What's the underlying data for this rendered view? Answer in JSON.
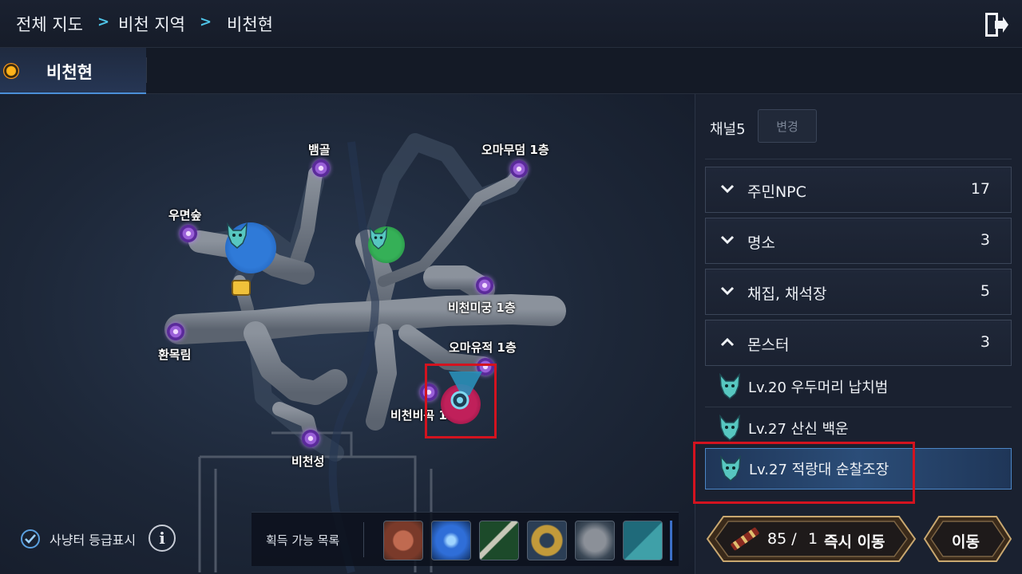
{
  "breadcrumb": {
    "items": [
      "전체 지도",
      "비천 지역",
      "비천현"
    ],
    "separator": ">"
  },
  "header": {
    "exit_icon": "exit-door-icon"
  },
  "tab": {
    "label": "비천현"
  },
  "map": {
    "locations": {
      "baemgol": "뱀골",
      "omamudeom": "오마무덤 1층",
      "umyeonsup": "우면숲",
      "bicheonmigung": "비천미궁 1층",
      "hwanmokrim": "환목림",
      "omayujeok": "오마유적 1층",
      "bicheonbigok": "비천비곡 1층",
      "bicheonseong": "비천성"
    },
    "colors": {
      "boss_blue": "#2a69c7",
      "boss_green": "#2c9a4a",
      "boss_red": "#a01848",
      "highlight": "#d3131f"
    }
  },
  "bottom": {
    "grade_display_label": "사냥터 등급표시",
    "grade_display_checked": true,
    "acquirable_label": "획득 가능 목록",
    "items": [
      "coin-item",
      "blue-orb-item",
      "staff-item",
      "dragon-ring-item",
      "armor-item",
      "book-item"
    ]
  },
  "panel": {
    "channel_label": "채널5",
    "change_button": "변경",
    "categories": [
      {
        "label": "주민NPC",
        "count": "17",
        "expanded": false
      },
      {
        "label": "명소",
        "count": "3",
        "expanded": false
      },
      {
        "label": "채집, 채석장",
        "count": "5",
        "expanded": false
      },
      {
        "label": "몬스터",
        "count": "3",
        "expanded": true
      }
    ],
    "monsters": [
      {
        "label": "Lv.20 우두머리 납치범",
        "selected": false
      },
      {
        "label": "Lv.27 산신 백운",
        "selected": false
      },
      {
        "label": "Lv.27 적랑대 순찰조장",
        "selected": true
      }
    ]
  },
  "teleport": {
    "count": "85 /",
    "cost": "1",
    "label": "즉시 이동",
    "move_label": "이동"
  }
}
